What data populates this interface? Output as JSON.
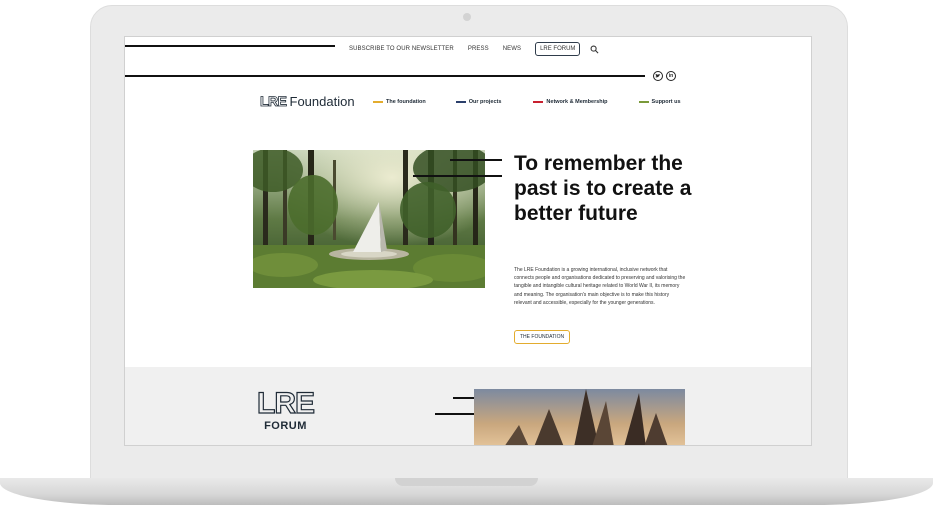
{
  "top_nav": {
    "newsletter": "SUBSCRIBE TO OUR NEWSLETTER",
    "press": "PRESS",
    "news": "NEWS",
    "forum": "LRE FORUM"
  },
  "brand": {
    "mark": "LRE",
    "name": "Foundation"
  },
  "main_nav": [
    {
      "label": "The foundation",
      "color": "#e3ac2e"
    },
    {
      "label": "Our projects",
      "color": "#2b3f6b"
    },
    {
      "label": "Network & Membership",
      "color": "#c8202f"
    },
    {
      "label": "Support us",
      "color": "#7a9a3a"
    }
  ],
  "hero": {
    "headline": "To remember the past is to create a better future",
    "body": "The LRE Foundation is a growing international, inclusive network that connects people and organisations dedicated to preserving and valorising the tangible and intangible cultural heritage related to World War II, its memory and meaning. The organisation's main objective is to make this history relevant and accessible, especially for the younger generations.",
    "button": "THE FOUNDATION"
  },
  "forum": {
    "mark": "LRE",
    "word": "FORUM"
  },
  "icons": [
    "search-icon",
    "twitter-icon",
    "linkedin-icon"
  ]
}
